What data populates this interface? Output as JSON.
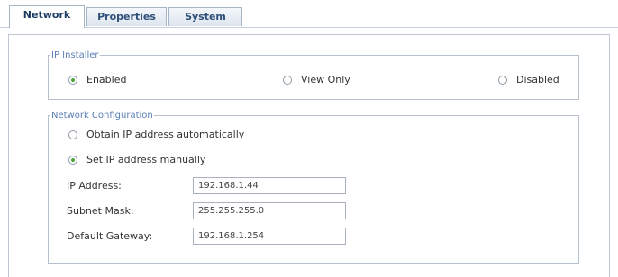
{
  "tabs": [
    {
      "label": "Network",
      "active": true
    },
    {
      "label": "Properties",
      "active": false
    },
    {
      "label": "System",
      "active": false
    }
  ],
  "ip_installer": {
    "legend": "IP Installer",
    "options": [
      {
        "label": "Enabled",
        "checked": true
      },
      {
        "label": "View Only",
        "checked": false
      },
      {
        "label": "Disabled",
        "checked": false
      }
    ]
  },
  "network_config": {
    "legend": "Network Configuration",
    "options": [
      {
        "label": "Obtain IP address automatically",
        "checked": false
      },
      {
        "label": "Set IP address manually",
        "checked": true
      }
    ],
    "fields": [
      {
        "label": "IP Address:",
        "value": "192.168.1.44"
      },
      {
        "label": "Subnet Mask:",
        "value": "255.255.255.0"
      },
      {
        "label": "Default Gateway:",
        "value": "192.168.1.254"
      }
    ]
  },
  "colors": {
    "accent_text": "#2e4f78",
    "legend_text": "#5a7fb5",
    "radio_checked": "#4aa43a"
  }
}
